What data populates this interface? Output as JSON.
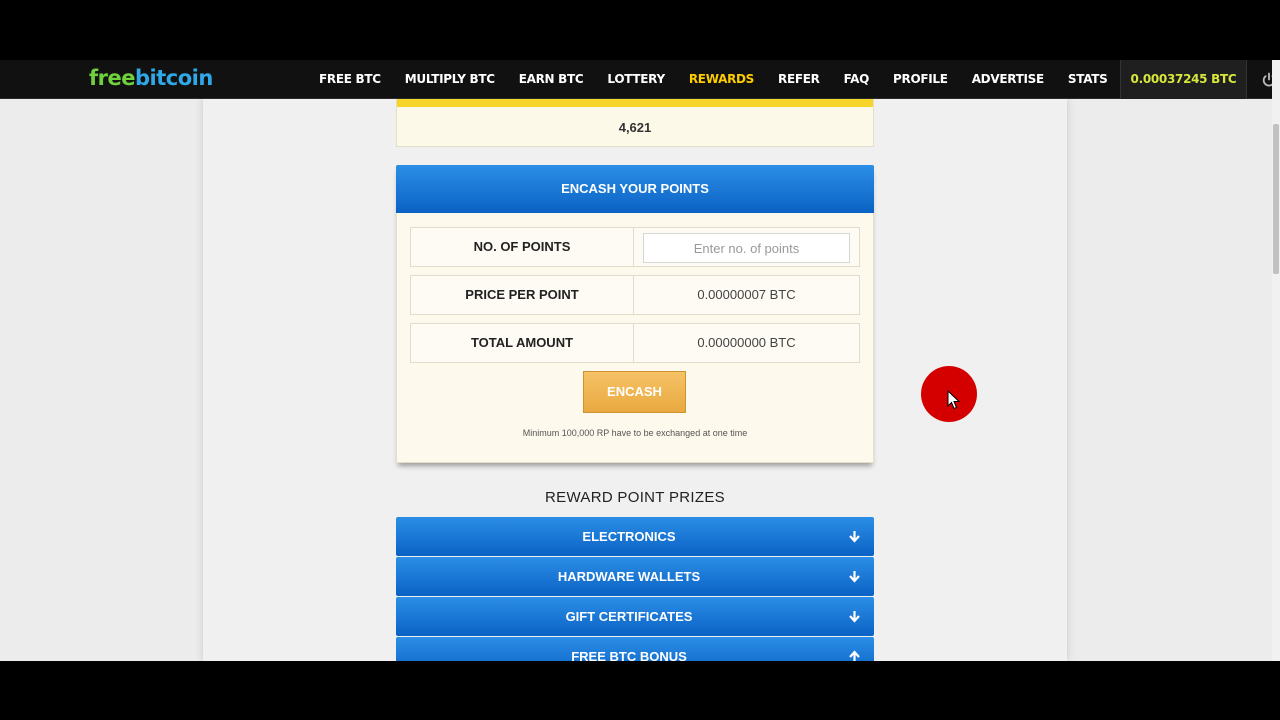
{
  "logo": {
    "part1": "free",
    "part2": "bitcoin"
  },
  "nav": {
    "items": [
      {
        "label": "FREE BTC",
        "active": false
      },
      {
        "label": "MULTIPLY BTC",
        "active": false
      },
      {
        "label": "EARN BTC",
        "active": false
      },
      {
        "label": "LOTTERY",
        "active": false
      },
      {
        "label": "REWARDS",
        "active": true
      },
      {
        "label": "REFER",
        "active": false
      },
      {
        "label": "FAQ",
        "active": false
      },
      {
        "label": "PROFILE",
        "active": false
      },
      {
        "label": "ADVERTISE",
        "active": false
      },
      {
        "label": "STATS",
        "active": false
      }
    ],
    "balance": "0.00037245 BTC",
    "power_icon": "power-icon"
  },
  "points": {
    "value": "4,621"
  },
  "encash": {
    "title": "ENCASH YOUR POINTS",
    "rows": [
      {
        "label": "NO. OF POINTS",
        "placeholder": "Enter no. of points",
        "value": ""
      },
      {
        "label": "PRICE PER POINT",
        "value": "0.00000007 BTC"
      },
      {
        "label": "TOTAL AMOUNT",
        "value": "0.00000000 BTC"
      }
    ],
    "button": "ENCASH",
    "note": "Minimum 100,000 RP have to be exchanged at one time"
  },
  "prizes": {
    "title": "REWARD POINT PRIZES",
    "categories": [
      {
        "label": "ELECTRONICS",
        "icon": "arrow-down-icon"
      },
      {
        "label": "HARDWARE WALLETS",
        "icon": "arrow-down-icon"
      },
      {
        "label": "GIFT CERTIFICATES",
        "icon": "arrow-down-icon"
      },
      {
        "label": "FREE BTC BONUS",
        "icon": "arrow-up-icon"
      }
    ]
  },
  "colors": {
    "accent_blue": "#0a62c4",
    "active_nav": "#ffcc00",
    "balance_text": "#d8e63c",
    "button_orange": "#e9a940",
    "cursor_highlight": "#d40000"
  }
}
